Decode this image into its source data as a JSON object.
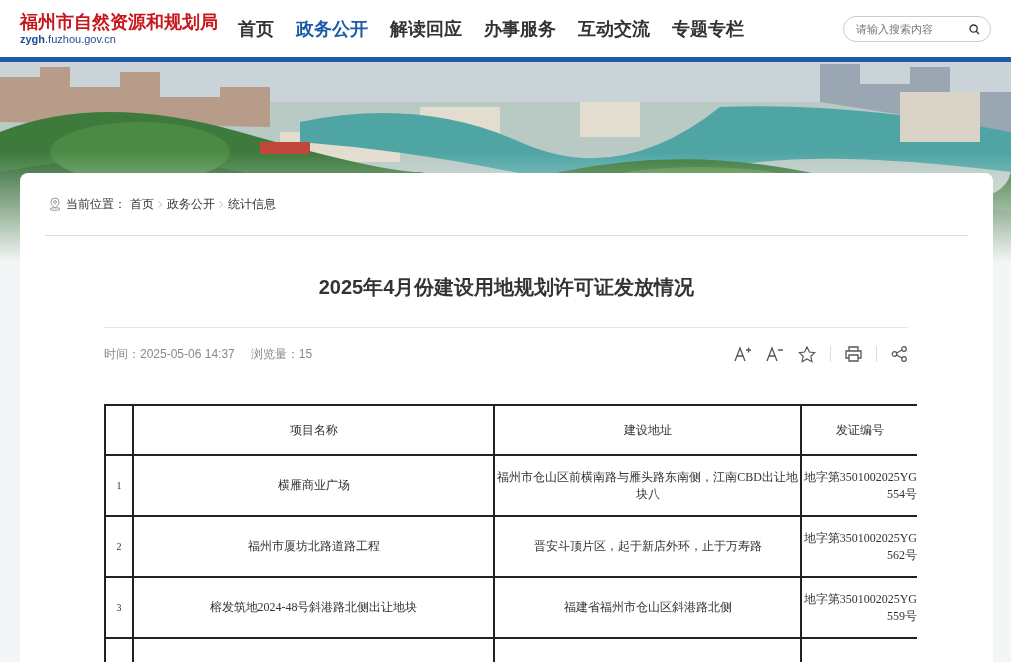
{
  "header": {
    "site_name": "福州市自然资源和规划局",
    "domain": "**zygh**.fuzhou.gov.cn",
    "nav": [
      {
        "label": "首页",
        "selected": false
      },
      {
        "label": "政务公开",
        "selected": true
      },
      {
        "label": "解读回应",
        "selected": false
      },
      {
        "label": "办事服务",
        "selected": false
      },
      {
        "label": "互动交流",
        "selected": false
      },
      {
        "label": "专题专栏",
        "selected": false
      }
    ],
    "search": {
      "placeholder": "请输入搜索内容"
    }
  },
  "breadcrumb": {
    "label": "当前位置：",
    "items": [
      "首页",
      "政务公开",
      "统计信息"
    ]
  },
  "article": {
    "title": "2025年4月份建设用地规划许可证发放情况",
    "time": "时间：2025-05-06 14:37",
    "views": "浏览量：15",
    "table": {
      "columns": [
        "",
        "项目名称",
        "建设地址",
        "发证编号"
      ],
      "rows": [
        {
          "index": "1",
          "name": "横雁商业广场",
          "address": "福州市仓山区前横南路与雁头路东南侧，江南CBD出让地块八",
          "permit": [
            "地字第3501002025YG",
            "554号"
          ]
        },
        {
          "index": "2",
          "name": "福州市厦坊北路道路工程",
          "address": "晋安斗顶片区，起于新店外环，止于万寿路",
          "permit": [
            "地字第3501002025YG",
            "562号"
          ]
        },
        {
          "index": "3",
          "name": "榕发筑地2024-48号斜港路北侧出让地块",
          "address": "福建省福州市仓山区斜港路北侧",
          "permit": [
            "地字第3501002025YG",
            "559号"
          ]
        }
      ]
    }
  }
}
